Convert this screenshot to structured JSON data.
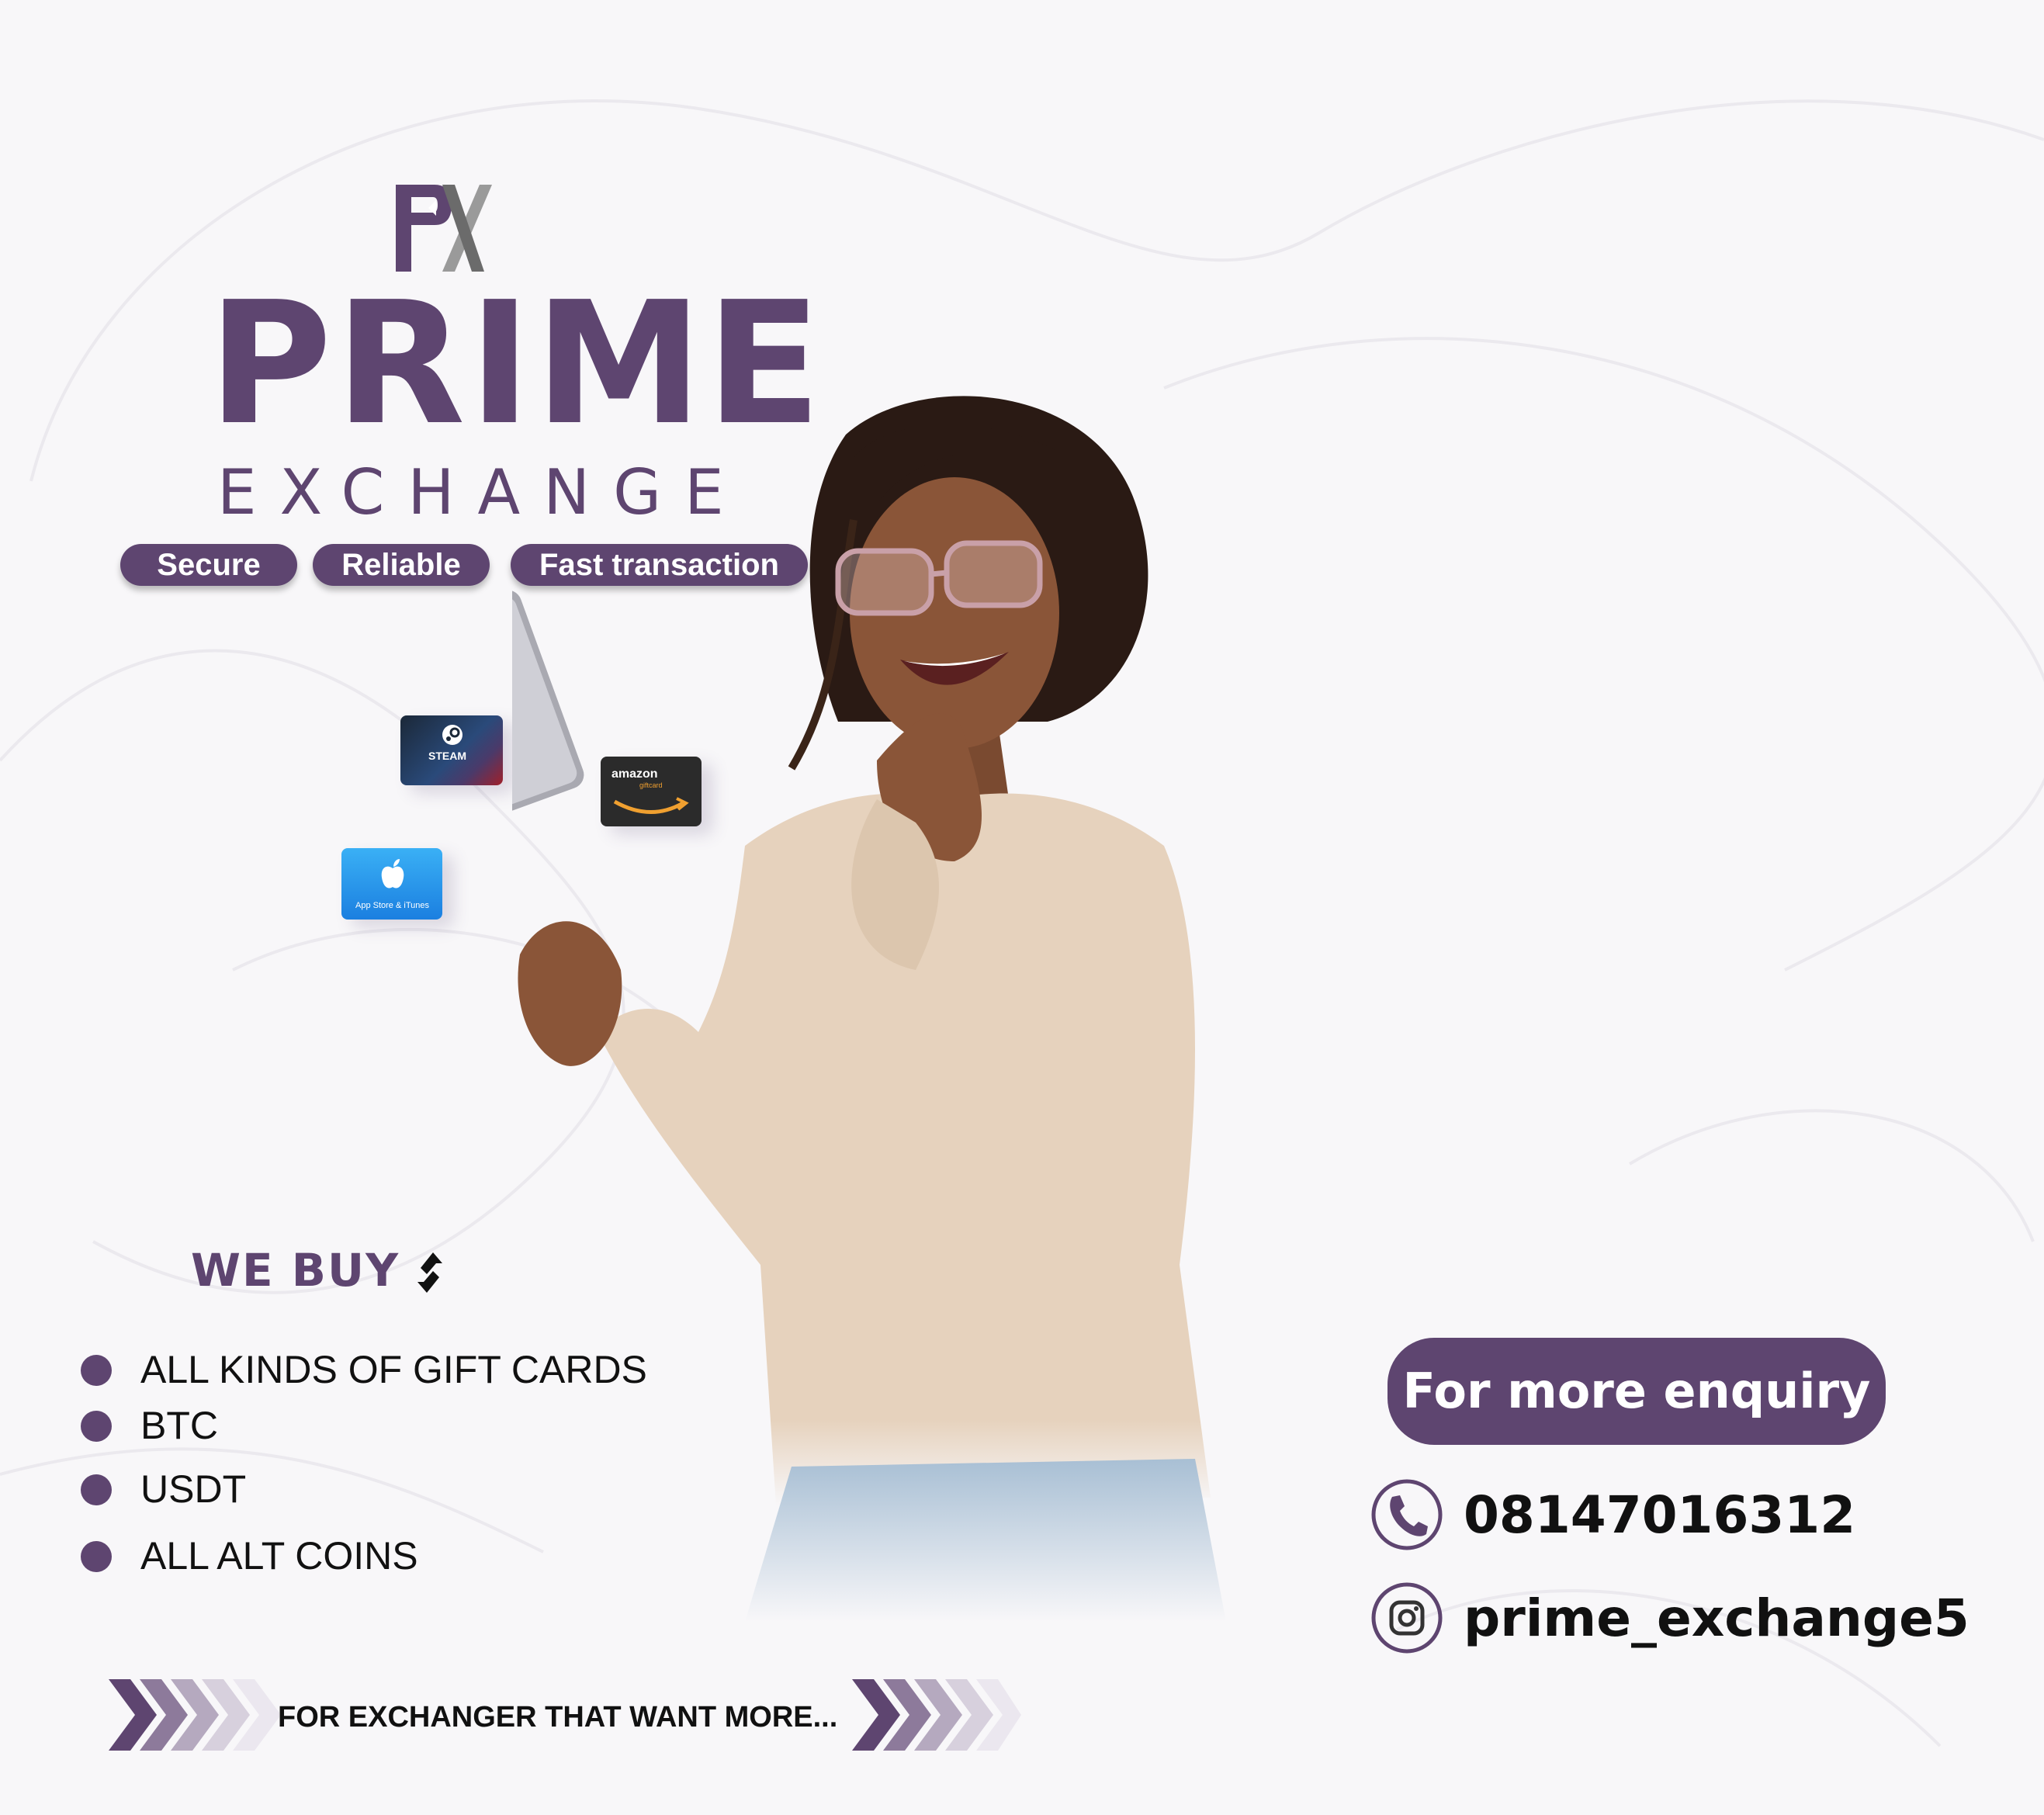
{
  "brand": {
    "logo_icon": "pk-monogram-icon",
    "title": "PRIME",
    "subtitle": "EXCHANGE"
  },
  "tags": [
    "Secure",
    "Reliable",
    "Fast transaction"
  ],
  "gift_cards": {
    "steam": "STEAM",
    "amazon_top": "amazon",
    "amazon_bottom": "giftcard",
    "apple": "App Store & iTunes"
  },
  "we_buy": {
    "heading": "WE BUY",
    "icon": "swap-arrows-icon",
    "items": [
      "ALL KINDS OF GIFT CARDS",
      "BTC",
      "USDT",
      "ALL ALT COINS"
    ]
  },
  "contact": {
    "enquiry_label": "For more enquiry",
    "phone_icon": "phone-icon",
    "phone": "08147016312",
    "instagram_icon": "instagram-icon",
    "instagram": "prime_exchange5"
  },
  "footer": {
    "tagline": "FOR EXCHANGER THAT WANT MORE..."
  },
  "colors": {
    "brand_purple": "#5e4570",
    "background": "#f8f7f9",
    "text_dark": "#111111"
  }
}
